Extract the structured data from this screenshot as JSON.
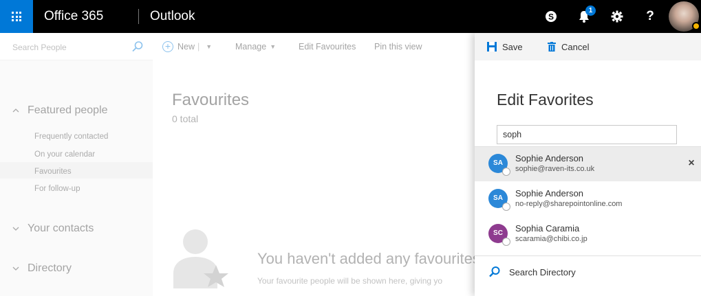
{
  "topbar": {
    "brand": "Office 365",
    "app": "Outlook",
    "notification_count": "1",
    "help_label": "?",
    "accent_color": "#0078d7"
  },
  "leftnav": {
    "search_placeholder": "Search People",
    "featured_label": "Featured people",
    "featured_items": [
      "Frequently contacted",
      "On your calendar",
      "Favourites",
      "For follow-up"
    ],
    "contacts_label": "Your contacts",
    "directory_label": "Directory"
  },
  "toolbar": {
    "new_label": "New",
    "manage_label": "Manage",
    "edit_favourites_label": "Edit Favourites",
    "pin_label": "Pin this view"
  },
  "main": {
    "title": "Favourites",
    "count": "0 total",
    "empty_title": "You haven't added any favourites y",
    "empty_sub": "Your favourite people will be shown here, giving yo"
  },
  "panel": {
    "save_label": "Save",
    "cancel_label": "Cancel",
    "title": "Edit Favorites",
    "search_value": "soph",
    "suggestions": [
      {
        "initials": "SA",
        "name": "Sophie Anderson",
        "email": "sophie@raven-its.co.uk",
        "color": "#2b88d8"
      },
      {
        "initials": "SA",
        "name": "Sophie Anderson",
        "email": "no-reply@sharepointonline.com",
        "color": "#2b88d8"
      },
      {
        "initials": "SC",
        "name": "Sophia Caramia",
        "email": "scaramia@chibi.co.jp",
        "color": "#8e3b8f"
      }
    ],
    "remove_symbol": "×",
    "search_directory_label": "Search Directory"
  }
}
